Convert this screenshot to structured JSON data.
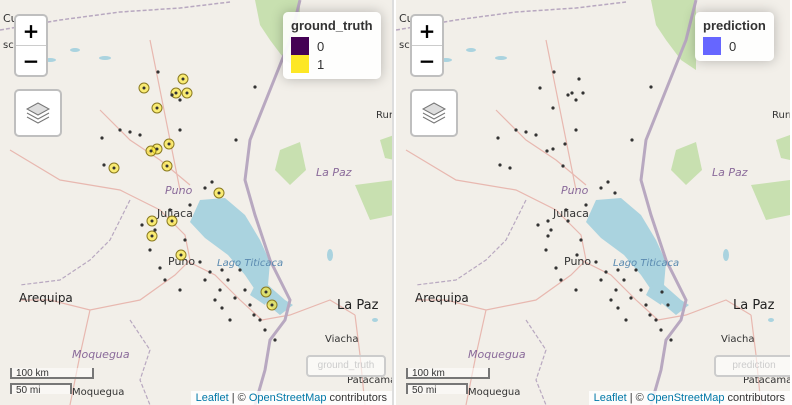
{
  "map": {
    "places": {
      "puno_region": "Puno",
      "juliaca": "Juliaca",
      "puno": "Puno",
      "lake": "Lago Titicaca",
      "arequipa": "Arequipa",
      "moquegua": "Moquegua",
      "la_paz_city": "La Paz",
      "la_paz_region": "La Paz",
      "viacha": "Viacha",
      "patacamaya": "Patacamay",
      "rurrenabaque": "Rurr",
      "cusco_fragment": "Cu",
      "sc_fragment": "sc"
    }
  },
  "zoom": {
    "in_label": "+",
    "out_label": "−"
  },
  "scale": {
    "metric": "100 km",
    "imperial": "50 mi"
  },
  "attribution": {
    "leaflet": "Leaflet",
    "separator": " | © ",
    "osm": "OpenStreetMap",
    "suffix": " contributors"
  },
  "left_panel": {
    "legend": {
      "title": "ground_truth",
      "items": [
        {
          "label": "0",
          "color": "#440154"
        },
        {
          "label": "1",
          "color": "#FDE725"
        }
      ]
    },
    "toggle_label": "ground_truth"
  },
  "right_panel": {
    "legend": {
      "title": "prediction",
      "items": [
        {
          "label": "0",
          "color": "#6666ff"
        }
      ]
    },
    "toggle_label": "prediction"
  },
  "colors": {
    "marker_dark": "#333333",
    "marker_yellow": "#FDE725",
    "water": "#aad3df",
    "park": "#c8e0b0",
    "border": "#9e8da8"
  }
}
